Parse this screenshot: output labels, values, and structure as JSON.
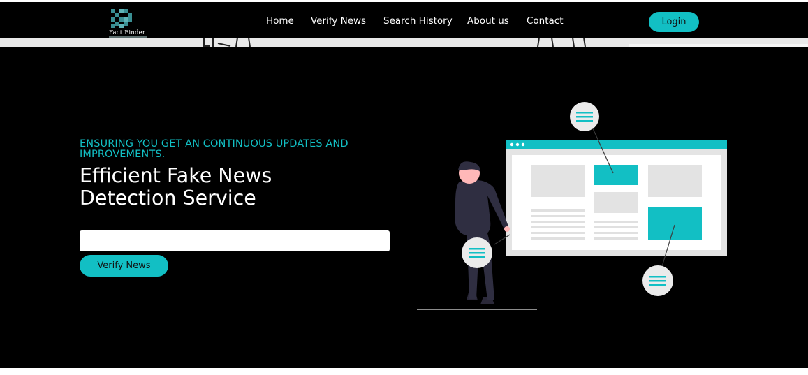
{
  "brand": {
    "name": "Fact Finder"
  },
  "nav": {
    "items": [
      {
        "label": "Home"
      },
      {
        "label": "Verify News"
      },
      {
        "label": "Search History"
      },
      {
        "label": "About us"
      },
      {
        "label": "Contact"
      }
    ],
    "login_label": "Login"
  },
  "hero": {
    "tagline": "ENSURING YOU GET AN CONTINUOUS UPDATES AND IMPROVEMENTS.",
    "headline_line1": "Efficient Fake News",
    "headline_line2": "Detection Service",
    "input_value": "",
    "verify_button": "Verify News"
  },
  "colors": {
    "accent": "#12bfc4",
    "background": "#000000",
    "text": "#ffffff"
  }
}
